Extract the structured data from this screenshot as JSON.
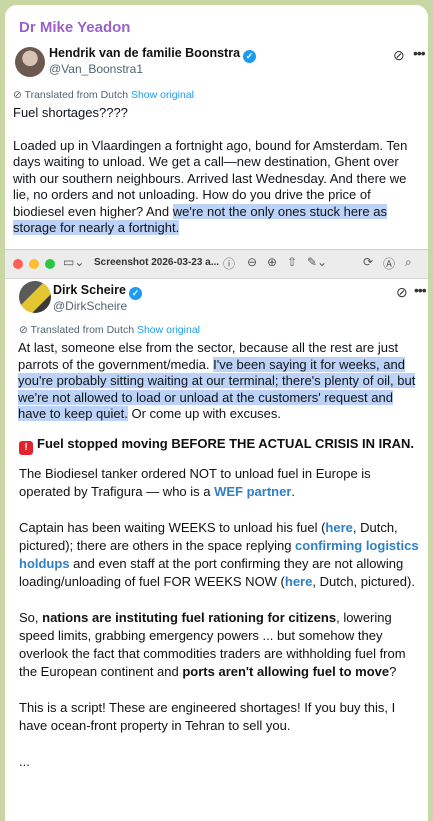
{
  "sender": "Dr Mike Yeadon",
  "tweet1": {
    "name": "Hendrik van de familie Boonstra",
    "handle": "@Van_Boonstra1",
    "translated_label": "Translated from Dutch",
    "show_original": "Show original",
    "line1": "Fuel shortages????",
    "para_plain": "Loaded up in Vlaardingen a fortnight ago, bound for Amsterdam. Ten days waiting to unload. We get a call—new destination, Ghent over with our southern neighbours. Arrived last Wednesday. And there we lie, no orders and not unloading. How do you drive the price of biodiesel even higher? And ",
    "para_highlight": "we're not the only ones stuck here as storage for nearly a fortnight."
  },
  "window": {
    "title": "Screenshot 2026-03-23 a...",
    "colors": {
      "close": "#ff5f57",
      "min": "#febc2e",
      "max": "#28c840"
    }
  },
  "tweet2": {
    "name": "Dirk Scheire",
    "handle": "@DirkScheire",
    "translated_label": "Translated from Dutch",
    "show_original": "Show original",
    "para_plain": "At last, someone else from the sector, because all the rest are just parrots of the government/media. ",
    "para_highlight": "I've been saying it for weeks, and you're probably sitting waiting at our terminal; there's plenty of oil, but we're not allowed to load or unload at the customers' request and have to keep quiet.",
    "para_tail": " Or come up with excuses."
  },
  "message": {
    "headline": "Fuel stopped moving BEFORE THE ACTUAL CRISIS IN IRAN.",
    "p2_a": "The Biodiesel tanker ordered NOT to unload fuel in Europe is operated by Trafigura — who is a ",
    "p2_link": "WEF partner",
    "p2_b": ".",
    "p3_a": "Captain has been waiting WEEKS to unload his fuel (",
    "p3_link1": "here",
    "p3_b": ", Dutch, pictured); there are others in the space replying ",
    "p3_link2": "confirming logistics holdups",
    "p3_c": " and even staff at the port confirming they are not allowing loading/unloading of fuel FOR WEEKS NOW (",
    "p3_link3": "here",
    "p3_d": ", Dutch, pictured).",
    "p4_a": "So, ",
    "p4_bold1": "nations are instituting fuel rationing for citizens",
    "p4_b": ", lowering speed limits, grabbing emergency powers ... but somehow they overlook the fact that commodities traders are withholding fuel from the European continent and ",
    "p4_bold2": "ports aren't allowing fuel to move",
    "p4_c": "?",
    "p5": "This is a script!  These are engineered shortages!  If you buy this, I have ocean-front property in Tehran to sell you.",
    "p6": "..."
  }
}
